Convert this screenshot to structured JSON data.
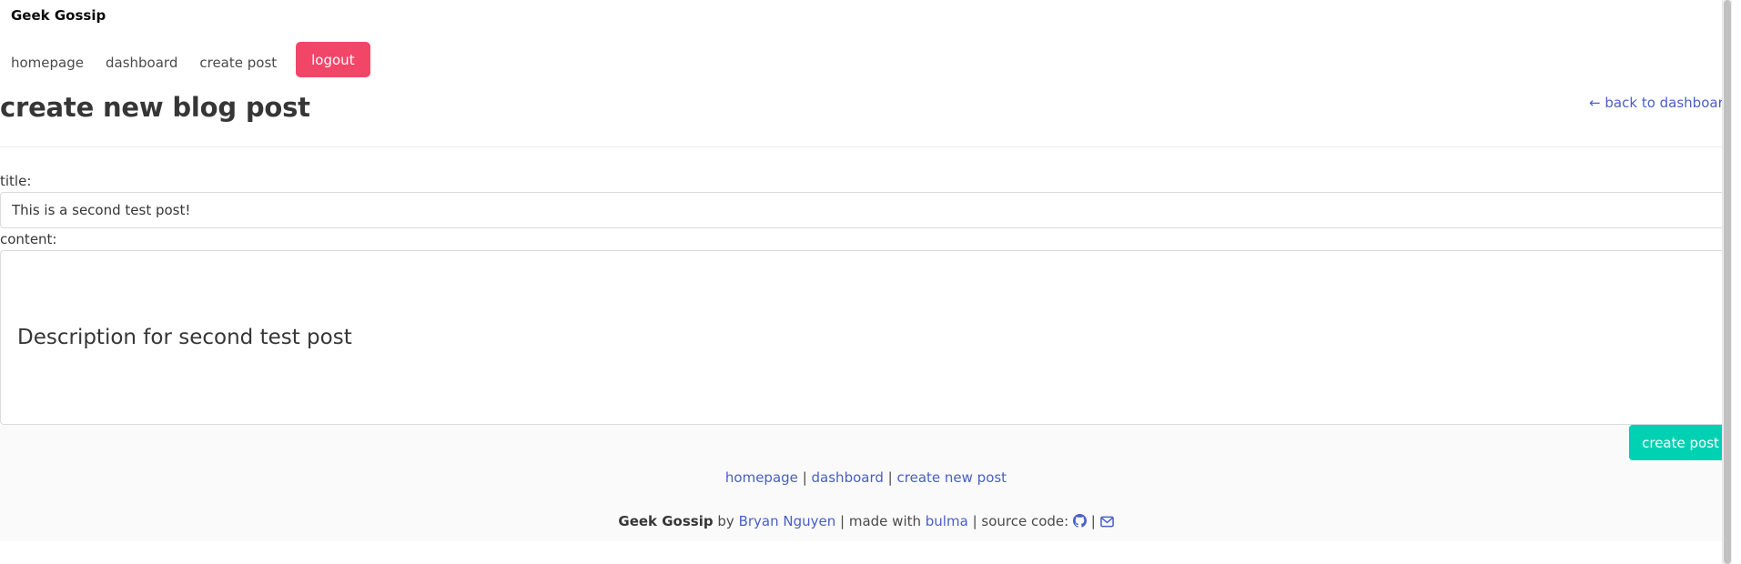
{
  "navbar": {
    "brand": "Geek Gossip",
    "links": [
      {
        "label": "homepage"
      },
      {
        "label": "dashboard"
      },
      {
        "label": "create post"
      }
    ],
    "logout_label": "logout",
    "logout_color": "#f14668"
  },
  "header": {
    "title": "create new blog post",
    "back_link": "← back to dashboard"
  },
  "form": {
    "title_label": "title:",
    "title_value": "This is a second test post!",
    "content_label": "content:",
    "content_value": "Description for second test post",
    "submit_label": "create post",
    "submit_color": "#00d1b2"
  },
  "footer": {
    "links": [
      {
        "label": "homepage"
      },
      {
        "label": "dashboard"
      },
      {
        "label": "create new post"
      }
    ],
    "separator": "|",
    "brand": "Geek Gossip",
    "by_text": "by",
    "author": "Bryan Nguyen",
    "made_with_text": "| made with",
    "framework": "bulma",
    "source_code_text": "| source code:",
    "icons": [
      "github-icon",
      "envelope-icon"
    ],
    "link_color": "#485fc7"
  }
}
